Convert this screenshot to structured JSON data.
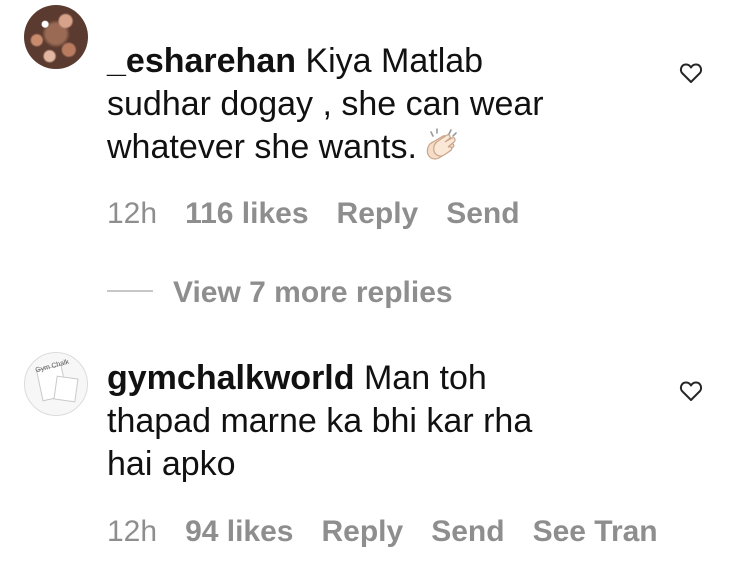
{
  "comments": [
    {
      "username": "_esharehan",
      "text_line1": " Kiya Matlab",
      "text_line2": "sudhar dogay , she can wear",
      "text_line3": "whatever she wants.",
      "emoji": "clapping-hands",
      "time": "12h",
      "likes": "116 likes",
      "reply": "Reply",
      "send": "Send"
    },
    {
      "username": "gymchalkworld",
      "avatar_text": "Gym Chalk",
      "text_line1": " Man toh",
      "text_line2": "thapad marne ka bhi kar rha",
      "text_line3": "hai apko",
      "time": "12h",
      "likes": "94 likes",
      "reply": "Reply",
      "send": "Send",
      "see_translation": "See Tran"
    }
  ],
  "view_replies": "View 7 more replies",
  "colors": {
    "meta": "#8e8e8e",
    "text": "#111111"
  }
}
